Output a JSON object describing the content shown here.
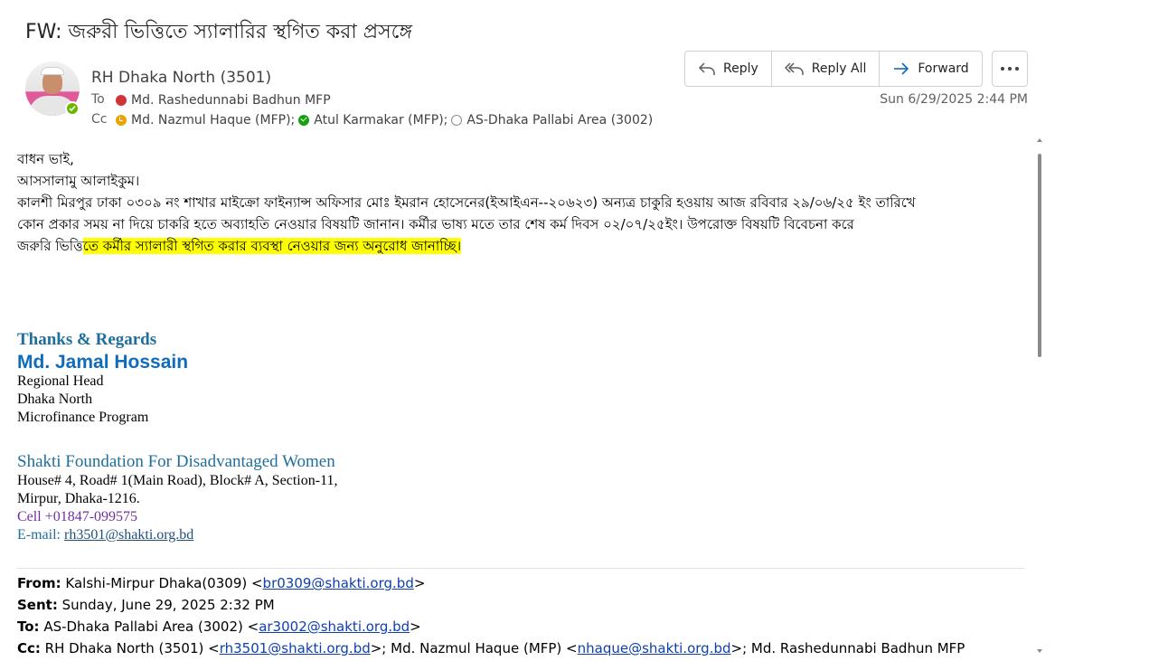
{
  "subject": "FW: জরুরী ভিত্তিতে স্যালারির স্থগিত করা প্রসঙ্গে",
  "header": {
    "sender": "RH  Dhaka North (3501)",
    "to_label": "To",
    "cc_label": "Cc",
    "to": [
      {
        "name": "Md. Rashedunnabi Badhun MFP",
        "status": "busy"
      }
    ],
    "cc": [
      {
        "name": "Md. Nazmul Haque (MFP);",
        "status": "away"
      },
      {
        "name": "Atul  Karmakar (MFP);",
        "status": "available"
      },
      {
        "name": "AS-Dhaka  Pallabi Area (3002)",
        "status": "offline"
      }
    ],
    "date": "Sun 6/29/2025 2:44 PM"
  },
  "actions": {
    "reply": "Reply",
    "reply_all": "Reply All",
    "forward": "Forward",
    "more_icon": "more-horizontal-icon"
  },
  "body": {
    "greeting": "বাধন  ভাই,",
    "salam": "আসসালামু  আলাইকুম।",
    "para_line1": "কালশী মিরপুর ঢাকা ০৩০৯ নং শাখার মাইক্রো ফাইন্যান্স অফিসার মোঃ ইমরান হোসেনের(ইআইএন--২০৬২৩) অন্যত্র চাকুরি হওয়ায় আজ রবিবার ২৯/০৬/২৫ ইং তারিখে",
    "para_line2": "কোন প্রকার সময় না দিয়ে চাকরি হতে অব্যাহতি নেওয়ার বিষয়টি জানান। কর্মীর  ভাষ্য মতে   তার শেষ কর্ম দিবস ০২/০৭/২৫ইং।  উপরোক্ত বিষয়টি বিবেচনা করে",
    "para_line3_plain": "জরুরি ভিত্তি",
    "para_line3_highlight": "তে কর্মীর স্যালারী স্থগিত করার ব্যবস্থা নেওয়ার জন্য অনুরোধ জানাচ্ছি।"
  },
  "signature": {
    "thanks": "Thanks & Regards",
    "name": "Md. Jamal Hossain",
    "title": "Regional Head",
    "region": "Dhaka North",
    "program": "Microfinance Program",
    "org": "Shakti Foundation For Disadvantaged Women",
    "address1": "House# 4, Road# 1(Main Road), Block# A, Section-11,",
    "address2": "Mirpur, Dhaka-1216.",
    "cell": "Cell +01847-099575",
    "email_label": "E-mail: ",
    "email": "rh3501@shakti.org.bd"
  },
  "forwarded": {
    "from_label": "From:",
    "from_name": " Kalshi-Mirpur Dhaka(0309) <",
    "from_email": "br0309@shakti.org.bd",
    "from_end": ">",
    "sent_label": "Sent:",
    "sent_value": " Sunday, June 29, 2025 2:32 PM",
    "to_label": "To:",
    "to_name": " AS-Dhaka Pallabi Area (3002) <",
    "to_email": "ar3002@shakti.org.bd",
    "to_end": ">",
    "cc_label": "Cc:",
    "cc_name1": " RH Dhaka North (3501) <",
    "cc_email1": "rh3501@shakti.org.bd",
    "cc_mid": ">; Md. Nazmul Haque (MFP) <",
    "cc_email2": "nhaque@shakti.org.bd",
    "cc_end": ">; Md. Rashedunnabi Badhun MFP"
  }
}
